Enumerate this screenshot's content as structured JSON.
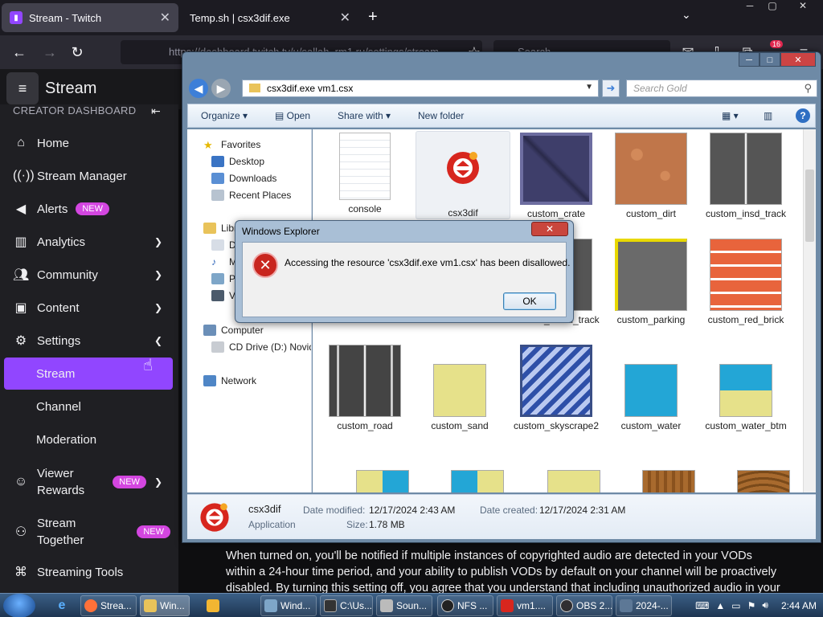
{
  "browser": {
    "tabs": [
      {
        "title": "Stream - Twitch",
        "active": true
      },
      {
        "title": "Temp.sh | csx3dif.exe",
        "active": false
      }
    ],
    "url": "https://dashboard.twitch.tv/u/sallah_rm1.ru/settings/stream",
    "search_placeholder": "Search",
    "notification_count": "16"
  },
  "twitch": {
    "header_title": "Stream",
    "section_label": "CREATOR DASHBOARD",
    "nav": [
      {
        "label": "Home",
        "icon": "home-icon"
      },
      {
        "label": "Stream Manager",
        "icon": "broadcast-icon"
      },
      {
        "label": "Alerts",
        "icon": "megaphone-icon",
        "badge": "NEW"
      },
      {
        "label": "Analytics",
        "icon": "chart-icon"
      },
      {
        "label": "Community",
        "icon": "community-icon"
      },
      {
        "label": "Content",
        "icon": "content-icon"
      },
      {
        "label": "Settings",
        "icon": "gear-icon"
      },
      {
        "label": "Viewer Rewards",
        "icon": "reward-icon",
        "badge": "NEW"
      },
      {
        "label": "Stream Together",
        "icon": "add-user-icon",
        "badge": "NEW"
      },
      {
        "label": "Streaming Tools",
        "icon": "tools-icon"
      }
    ],
    "settings_sub": [
      "Stream",
      "Channel",
      "Moderation"
    ],
    "viewer_rewards_lines": [
      "Viewer",
      "Rewards"
    ],
    "stream_together_lines": [
      "Stream",
      "Together"
    ],
    "body_text": "When turned on, you'll be notified if multiple instances of copyrighted audio are detected in your VODs within a 24-hour time period, and your ability to publish VODs by default on your channel will be proactively disabled. By turning this setting off, you agree that you understand that including unauthorized audio in your content"
  },
  "explorer": {
    "address": "csx3dif.exe vm1.csx",
    "search_placeholder": "Search Gold",
    "commands": [
      "Organize",
      "Open",
      "Share with",
      "New folder"
    ],
    "nav": {
      "favorites": "Favorites",
      "desktop": "Desktop",
      "downloads": "Downloads",
      "recent": "Recent Places",
      "libraries": "Libr",
      "lib1": "Do",
      "lib2": "M",
      "lib3": "Pi",
      "lib4": "Vi",
      "computer": "Computer",
      "cd": "CD Drive (D:) Novide",
      "network": "Network"
    },
    "files": [
      {
        "name": "console",
        "kind": "document"
      },
      {
        "name": "csx3dif",
        "kind": "app"
      },
      {
        "name": "custom_crate",
        "kind": "crate"
      },
      {
        "name": "custom_dirt",
        "kind": "dirt"
      },
      {
        "name": "custom_insd_track",
        "kind": "track"
      },
      {
        "name": "",
        "kind": "hidden"
      },
      {
        "name": "",
        "kind": "hidden"
      },
      {
        "name": "custom_outsd_track",
        "kind": "track2"
      },
      {
        "name": "custom_parking",
        "kind": "parking"
      },
      {
        "name": "custom_red_brick",
        "kind": "brick"
      },
      {
        "name": "custom_road",
        "kind": "road"
      },
      {
        "name": "custom_sand",
        "kind": "sand"
      },
      {
        "name": "custom_skyscrape2",
        "kind": "glass"
      },
      {
        "name": "custom_water",
        "kind": "water"
      },
      {
        "name": "custom_water_btm",
        "kind": "waterbtm"
      }
    ],
    "details": {
      "name": "csx3dif",
      "type": "Application",
      "modified_label": "Date modified:",
      "modified": "12/17/2024 2:43 AM",
      "created_label": "Date created:",
      "created": "12/17/2024 2:31 AM",
      "size_label": "Size:",
      "size": "1.78 MB"
    }
  },
  "dialog": {
    "title": "Windows Explorer",
    "message": "Accessing the resource 'csx3dif.exe vm1.csx' has been disallowed.",
    "ok": "OK"
  },
  "taskbar": {
    "items": [
      "Strea...",
      "Win...",
      "Wind...",
      "C:\\Us...",
      "Soun...",
      "NFS ...",
      "vm1....",
      "OBS 2...",
      "2024-..."
    ],
    "clock": "2:44 AM"
  },
  "colors": {
    "twitch_purple": "#9146ff",
    "badge_pink": "#d346e0",
    "error_red": "#c8261f"
  }
}
